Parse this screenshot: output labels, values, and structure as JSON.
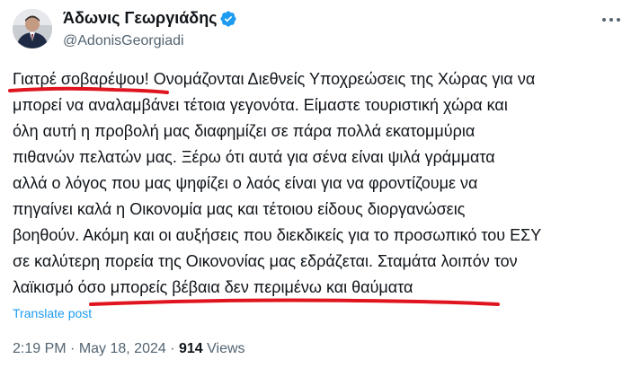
{
  "author": {
    "display_name": "Άδωνις Γεωργιάδης",
    "handle": "@AdonisGeorgiadi",
    "verified_icon": "verified-badge-icon",
    "avatar_icon": "profile-photo"
  },
  "more_icon": "more-horizontal-icon",
  "tweet": {
    "lines": [
      "Γιατρέ σοβαρέψου! Ονομάζονται Διεθνείς Υποχρεώσεις της Χώρας για να",
      "μπορεί να αναλαμβάνει τέτοια γεγονότα. Είμαστε τουριστική χώρα και",
      "όλη αυτή η προβολή μας διαφημίζει σε πάρα πολλά εκατομμύρια",
      "πιθανών πελατών μας. Ξέρω ότι αυτά για σένα είναι ψιλά γράμματα",
      "αλλά ο λόγος που μας ψηφίζει ο λαός είναι για να φροντίζουμε να",
      "πηγαίνει καλά η Οικονομία μας και τέτοιου είδους διοργανώσεις",
      "βοηθούν. Ακόμη και οι αυξήσεις που διεκδικείς για το προσωπικό του ΕΣΥ",
      "σε καλύτερη πορεία της Οικονονίας μας εδράζεται. Σταμάτα λοιπόν τον",
      "λαϊκισμό όσο μπορείς βέβαια δεν περιμένω και θαύματα"
    ],
    "highlight_color": "#e0141e"
  },
  "translate_label": "Translate post",
  "meta": {
    "time": "2:19 PM",
    "separator_1": " · ",
    "date": "May 18, 2024",
    "separator_2": " · ",
    "views_count": "914",
    "views_label": " Views"
  },
  "colors": {
    "text": "#0f1419",
    "secondary": "#536471",
    "link": "#1d9bf0",
    "verified": "#1d9bf0"
  }
}
